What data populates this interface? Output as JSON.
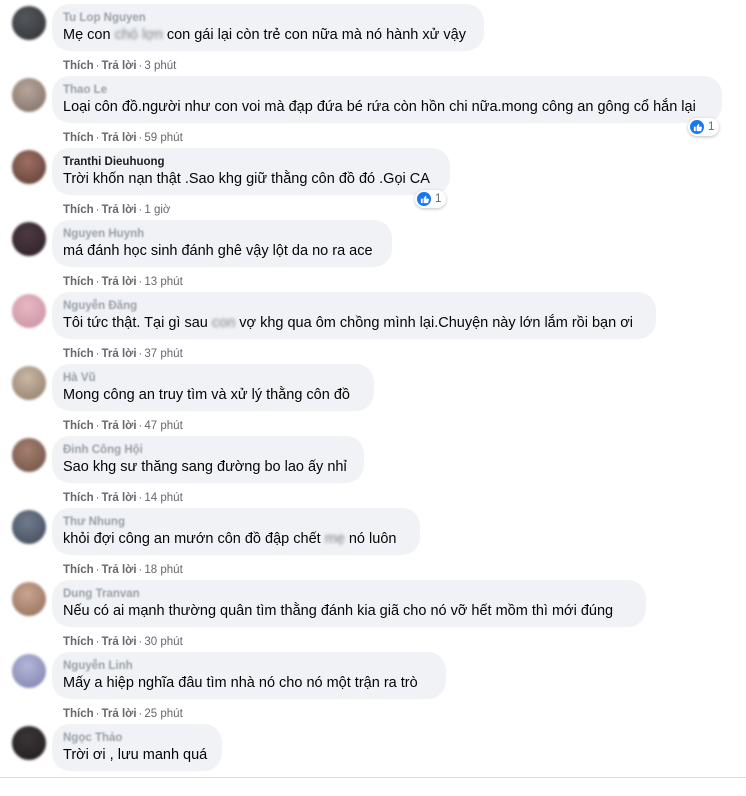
{
  "actions": {
    "like": "Thích",
    "reply": "Trả lời",
    "separator": "·"
  },
  "comments": [
    {
      "author": "Tu Lop Nguyen",
      "text_pre": "Mẹ con ",
      "text_blur": "chó lợn",
      "text_post": " con gái lại còn trẻ con nữa mà nó hành xử vậy",
      "time": "3 phút",
      "avatar": [
        "#54575c",
        "#2f3134"
      ]
    },
    {
      "author": "Thao Le",
      "text": "Loại côn đồ.người như con voi mà đạp đứa bé rứa còn hồn chi nữa.mong công an gông cổ hắn lại",
      "time": "59 phút",
      "reaction_count": "1",
      "avatar": [
        "#b7a69b",
        "#7d6c62"
      ]
    },
    {
      "author": "Tranthi Dieuhuong",
      "text": "Trời khốn nạn thật .Sao khg giữ thằng côn đồ đó .Gọi CA",
      "time": "1 giờ",
      "reaction_count": "1",
      "avatar": [
        "#9e6f62",
        "#5b3c35"
      ]
    },
    {
      "author": "Nguyen Huynh",
      "text": "má đánh học sinh đánh ghê vậy lột da no ra ace",
      "time": "13 phút",
      "avatar": [
        "#4d3942",
        "#2b1f25"
      ]
    },
    {
      "author": "Nguyễn Đăng",
      "text_pre": "Tôi tức thật. Tại gì sau ",
      "text_blur": "con",
      "text_post": " vợ khg qua ôm chồng mình lại.Chuyện này lớn lắm rồi bạn ơi",
      "time": "37 phút",
      "avatar": [
        "#e6b7c3",
        "#c98fa0"
      ]
    },
    {
      "author": "Hà Vũ",
      "text": "Mong công an truy tìm và xử lý thằng côn đồ",
      "time": "47 phút",
      "avatar": [
        "#c9b8a5",
        "#8e7a68"
      ]
    },
    {
      "author": "Đinh Công Hội",
      "text": "Sao khg sư thăng sang đường bo lao ấy nhỉ",
      "time": "14 phút",
      "avatar": [
        "#a57f6e",
        "#6b5046"
      ]
    },
    {
      "author": "Thư Nhung",
      "text_pre": "khỏi đợi công an mướn côn đồ đập chết ",
      "text_blur": "mẹ",
      "text_post": " nó luôn",
      "time": "18 phút",
      "avatar": [
        "#707c8e",
        "#3f4858"
      ]
    },
    {
      "author": "Dung Tranvan",
      "text": "Nếu có ai mạnh thường quân tìm thằng đánh kia giã cho nó vỡ hết mồm thì mới đúng",
      "time": "30 phút",
      "avatar": [
        "#caa58f",
        "#8f6d5a"
      ]
    },
    {
      "author": "Nguyễn Linh",
      "text": "Mấy a hiệp nghĩa đâu tìm nhà nó cho nó một trận ra trò",
      "time": "25 phút",
      "avatar": [
        "#b4b6d8",
        "#7c7fae"
      ]
    },
    {
      "author": "Ngọc Thảo",
      "text": "Trời ơi , lưu manh quá",
      "time": "",
      "avatar": [
        "#3b3536",
        "#1f1b1c"
      ]
    }
  ]
}
